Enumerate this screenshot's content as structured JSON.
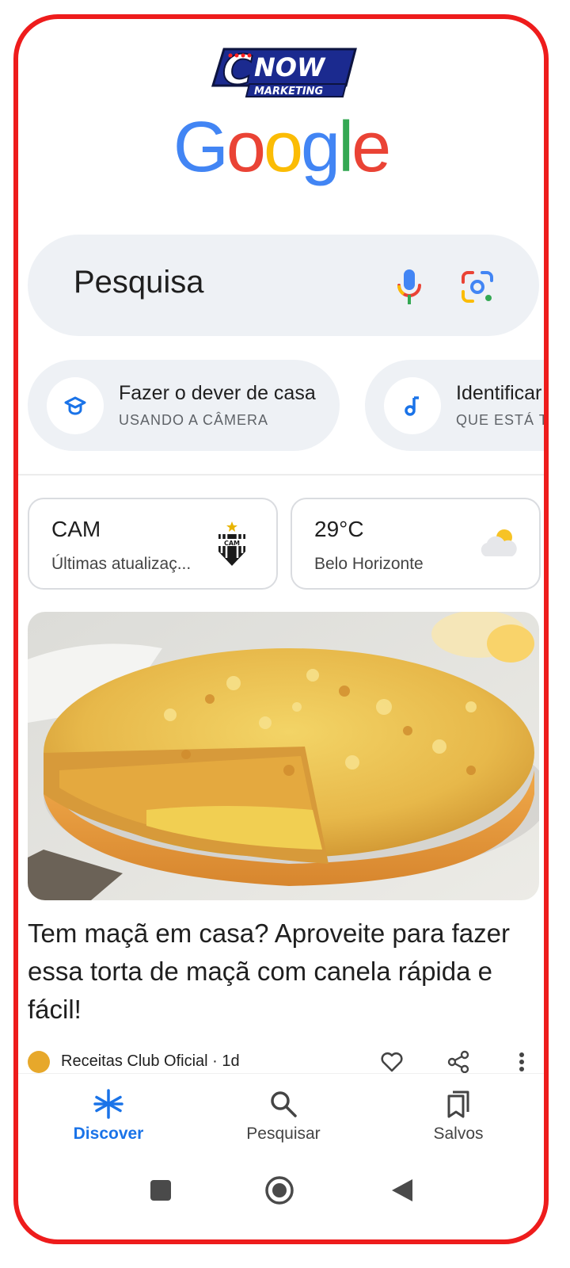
{
  "logo": {
    "line1": "NOW",
    "line2": "MARKETING"
  },
  "google_logo": "Google",
  "search": {
    "placeholder": "Pesquisa"
  },
  "chips": [
    {
      "title": "Fazer o dever de casa",
      "subtitle": "USANDO A CÂMERA",
      "icon": "graduation-cap-icon"
    },
    {
      "title": "Identificar",
      "subtitle": "QUE ESTÁ T",
      "icon": "music-note-icon"
    }
  ],
  "cards": [
    {
      "title": "CAM",
      "subtitle": "Últimas atualizaç...",
      "icon": "cam-crest-icon"
    },
    {
      "title": "29°C",
      "subtitle": "Belo Horizonte",
      "icon": "partly-cloudy-icon"
    }
  ],
  "crest_text": "CAM",
  "article": {
    "headline": "Tem maçã em casa? Aproveite para fazer essa torta de maçã com canela rápida e fácil!",
    "source": "Receitas Club Oficial · 1d"
  },
  "nav": [
    {
      "label": "Discover",
      "active": true
    },
    {
      "label": "Pesquisar",
      "active": false
    },
    {
      "label": "Salvos",
      "active": false
    }
  ],
  "colors": {
    "frame": "#ee1c1c",
    "accent": "#1a73e8",
    "surface": "#eef1f5"
  }
}
